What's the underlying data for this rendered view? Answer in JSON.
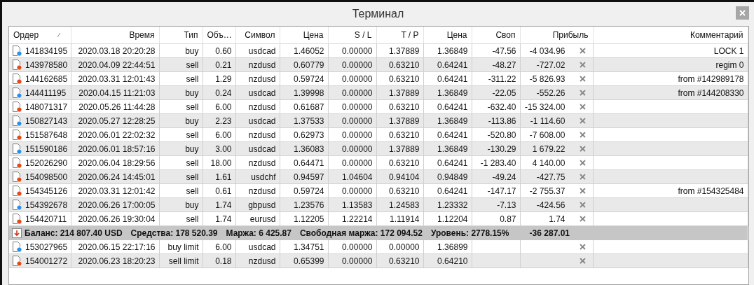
{
  "window": {
    "title": "Терминал"
  },
  "table": {
    "columns": [
      "Ордер",
      "Время",
      "Тип",
      "Объ…",
      "Символ",
      "Цена",
      "S / L",
      "T / P",
      "Цена",
      "Своп",
      "Прибыль",
      "Комментарий"
    ],
    "rows": [
      {
        "kind": "buy",
        "order": "141834195",
        "time": "2020.03.18 20:20:28",
        "type": "buy",
        "volume": "0.60",
        "symbol": "usdcad",
        "price": "1.46052",
        "sl": "0.00000",
        "tp": "1.37889",
        "current_price": "1.36849",
        "swap": "-47.56",
        "profit": "-4 034.96",
        "comment": "LOCK 1"
      },
      {
        "kind": "sell",
        "order": "143978580",
        "time": "2020.04.09 22:44:51",
        "type": "sell",
        "volume": "0.21",
        "symbol": "nzdusd",
        "price": "0.60779",
        "sl": "0.00000",
        "tp": "0.63210",
        "current_price": "0.64241",
        "swap": "-48.27",
        "profit": "-727.02",
        "comment": "regim 0"
      },
      {
        "kind": "sell",
        "order": "144162685",
        "time": "2020.03.31 12:01:43",
        "type": "sell",
        "volume": "1.29",
        "symbol": "nzdusd",
        "price": "0.59724",
        "sl": "0.00000",
        "tp": "0.63210",
        "current_price": "0.64241",
        "swap": "-311.22",
        "profit": "-5 826.93",
        "comment": "from #142989178"
      },
      {
        "kind": "buy",
        "order": "144411195",
        "time": "2020.04.15 11:21:03",
        "type": "buy",
        "volume": "0.24",
        "symbol": "usdcad",
        "price": "1.39998",
        "sl": "0.00000",
        "tp": "1.37889",
        "current_price": "1.36849",
        "swap": "-22.05",
        "profit": "-552.26",
        "comment": "from #144208330"
      },
      {
        "kind": "sell",
        "order": "148071317",
        "time": "2020.05.26 11:44:28",
        "type": "sell",
        "volume": "6.00",
        "symbol": "nzdusd",
        "price": "0.61687",
        "sl": "0.00000",
        "tp": "0.63210",
        "current_price": "0.64241",
        "swap": "-632.40",
        "profit": "-15 324.00"
      },
      {
        "kind": "buy",
        "order": "150827143",
        "time": "2020.05.27 12:28:25",
        "type": "buy",
        "volume": "2.23",
        "symbol": "usdcad",
        "price": "1.37533",
        "sl": "0.00000",
        "tp": "1.37889",
        "current_price": "1.36849",
        "swap": "-113.86",
        "profit": "-1 114.60"
      },
      {
        "kind": "sell",
        "order": "151587648",
        "time": "2020.06.01 22:02:32",
        "type": "sell",
        "volume": "6.00",
        "symbol": "nzdusd",
        "price": "0.62973",
        "sl": "0.00000",
        "tp": "0.63210",
        "current_price": "0.64241",
        "swap": "-520.80",
        "profit": "-7 608.00"
      },
      {
        "kind": "buy",
        "order": "151590186",
        "time": "2020.06.01 18:57:16",
        "type": "buy",
        "volume": "3.00",
        "symbol": "usdcad",
        "price": "1.36083",
        "sl": "0.00000",
        "tp": "1.37889",
        "current_price": "1.36849",
        "swap": "-130.29",
        "profit": "1 679.22"
      },
      {
        "kind": "sell",
        "order": "152026290",
        "time": "2020.06.04 18:29:56",
        "type": "sell",
        "volume": "18.00",
        "symbol": "nzdusd",
        "price": "0.64471",
        "sl": "0.00000",
        "tp": "0.63210",
        "current_price": "0.64241",
        "swap": "-1 283.40",
        "profit": "4 140.00"
      },
      {
        "kind": "sell",
        "order": "154098500",
        "time": "2020.06.24 14:45:01",
        "type": "sell",
        "volume": "1.61",
        "symbol": "usdchf",
        "price": "0.94597",
        "sl": "1.04604",
        "tp": "0.94104",
        "current_price": "0.94849",
        "swap": "-49.24",
        "profit": "-427.75"
      },
      {
        "kind": "sell",
        "order": "154345126",
        "time": "2020.03.31 12:01:42",
        "type": "sell",
        "volume": "0.61",
        "symbol": "nzdusd",
        "price": "0.59724",
        "sl": "0.00000",
        "tp": "0.63210",
        "current_price": "0.64241",
        "swap": "-147.17",
        "profit": "-2 755.37",
        "comment": "from #154325484"
      },
      {
        "kind": "buy",
        "order": "154392678",
        "time": "2020.06.26 17:00:05",
        "type": "buy",
        "volume": "1.74",
        "symbol": "gbpusd",
        "price": "1.23576",
        "sl": "1.13583",
        "tp": "1.24583",
        "current_price": "1.23332",
        "swap": "-7.13",
        "profit": "-424.56"
      },
      {
        "kind": "sell",
        "order": "154420711",
        "time": "2020.06.26 19:30:04",
        "type": "sell",
        "volume": "1.74",
        "symbol": "eurusd",
        "price": "1.12205",
        "sl": "1.22214",
        "tp": "1.11914",
        "current_price": "1.12204",
        "swap": "0.87",
        "profit": "1.74"
      }
    ],
    "summary": {
      "items": [
        "Баланс: 214 807.40 USD",
        "Средства: 178 520.39",
        "Маржа: 6 425.87",
        "Свободная маржа: 172 094.52",
        "Уровень: 2778.15%"
      ],
      "profit": "-36 287.01"
    },
    "pending_orders": [
      {
        "kind": "buy",
        "order": "153027965",
        "time": "2020.06.15 22:17:16",
        "type": "buy limit",
        "volume": "6.00",
        "symbol": "usdcad",
        "price": "1.34751",
        "sl": "0.00000",
        "tp": "0.00000",
        "current_price": "1.36899"
      },
      {
        "kind": "sell",
        "order": "154001272",
        "time": "2020.06.23 18:20:23",
        "type": "sell limit",
        "volume": "0.18",
        "symbol": "nzdusd",
        "price": "0.65399",
        "sl": "0.00000",
        "tp": "0.63210",
        "current_price": "0.64210"
      }
    ]
  }
}
